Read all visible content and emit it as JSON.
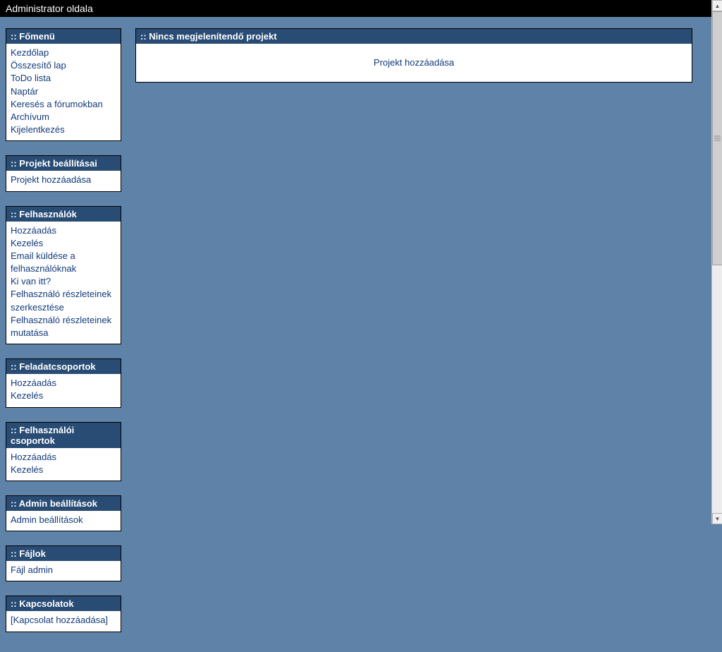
{
  "header": {
    "title": "Administrator oldala"
  },
  "sidebar": {
    "panels": [
      {
        "title": ":: Főmenü",
        "items": [
          "Kezdőlap",
          "Összesítő lap",
          "ToDo lista",
          "Naptár",
          "Keresés a fórumokban",
          "Archívum",
          "Kijelentkezés"
        ]
      },
      {
        "title": ":: Projekt beállításai",
        "items": [
          "Projekt hozzáadása"
        ]
      },
      {
        "title": ":: Felhasználók",
        "items": [
          "Hozzáadás",
          "Kezelés",
          "Email küldése a felhasználóknak",
          "Ki van itt?",
          "Felhasználó részleteinek szerkesztése",
          "Felhasználó részleteinek mutatása"
        ]
      },
      {
        "title": ":: Feladatcsoportok",
        "items": [
          "Hozzáadás",
          "Kezelés"
        ]
      },
      {
        "title": ":: Felhasználói csoportok",
        "items": [
          "Hozzáadás",
          "Kezelés"
        ]
      },
      {
        "title": ":: Admin beállítások",
        "items": [
          "Admin beállítások"
        ]
      },
      {
        "title": ":: Fájlok",
        "items": [
          "Fájl admin"
        ]
      },
      {
        "title": ":: Kapcsolatok",
        "items": [
          "[Kapcsolat hozzáadása]"
        ]
      }
    ]
  },
  "main": {
    "panel_title": ":: Nincs megjelenítendő projekt",
    "add_project_link": "Projekt hozzáadása"
  }
}
